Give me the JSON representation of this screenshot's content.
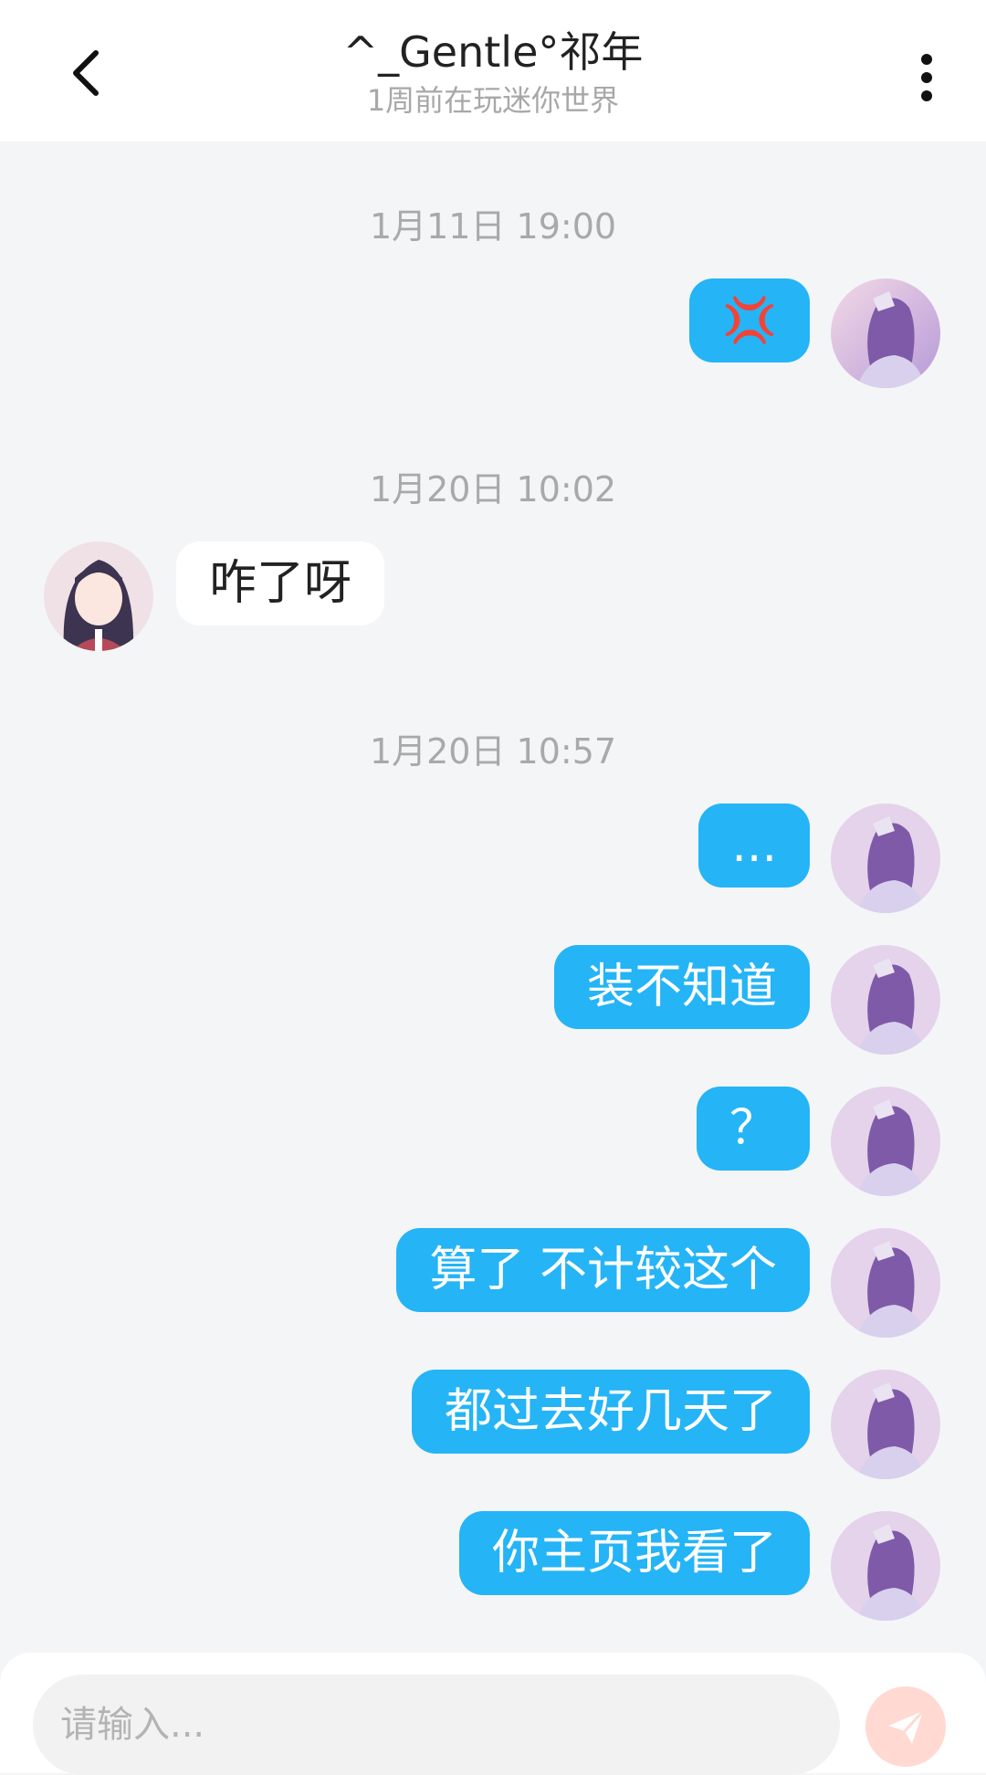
{
  "header": {
    "title": "^_Gentle°祁年",
    "subtitle": "1周前在玩迷你世界",
    "back_icon": "chevron-left-icon",
    "more_icon": "more-vertical-icon"
  },
  "messages": [
    {
      "type": "time",
      "text": "1月11日 19:00"
    },
    {
      "type": "out",
      "text": "💢"
    },
    {
      "type": "time",
      "text": "1月20日 10:02"
    },
    {
      "type": "in",
      "text": "咋了呀"
    },
    {
      "type": "time",
      "text": "1月20日 10:57"
    },
    {
      "type": "out",
      "text": "..."
    },
    {
      "type": "out",
      "text": "装不知道"
    },
    {
      "type": "out",
      "text": "？"
    },
    {
      "type": "out",
      "text": "算了 不计较这个"
    },
    {
      "type": "out",
      "text": "都过去好几天了"
    },
    {
      "type": "out",
      "text": "你主页我看了"
    }
  ],
  "composer": {
    "placeholder": "请输入...",
    "send_icon": "send-icon"
  },
  "colors": {
    "out_bubble": "#25b4f6",
    "in_bubble": "#ffffff",
    "background": "#f4f5f7",
    "send_button": "#ffd9d2"
  }
}
